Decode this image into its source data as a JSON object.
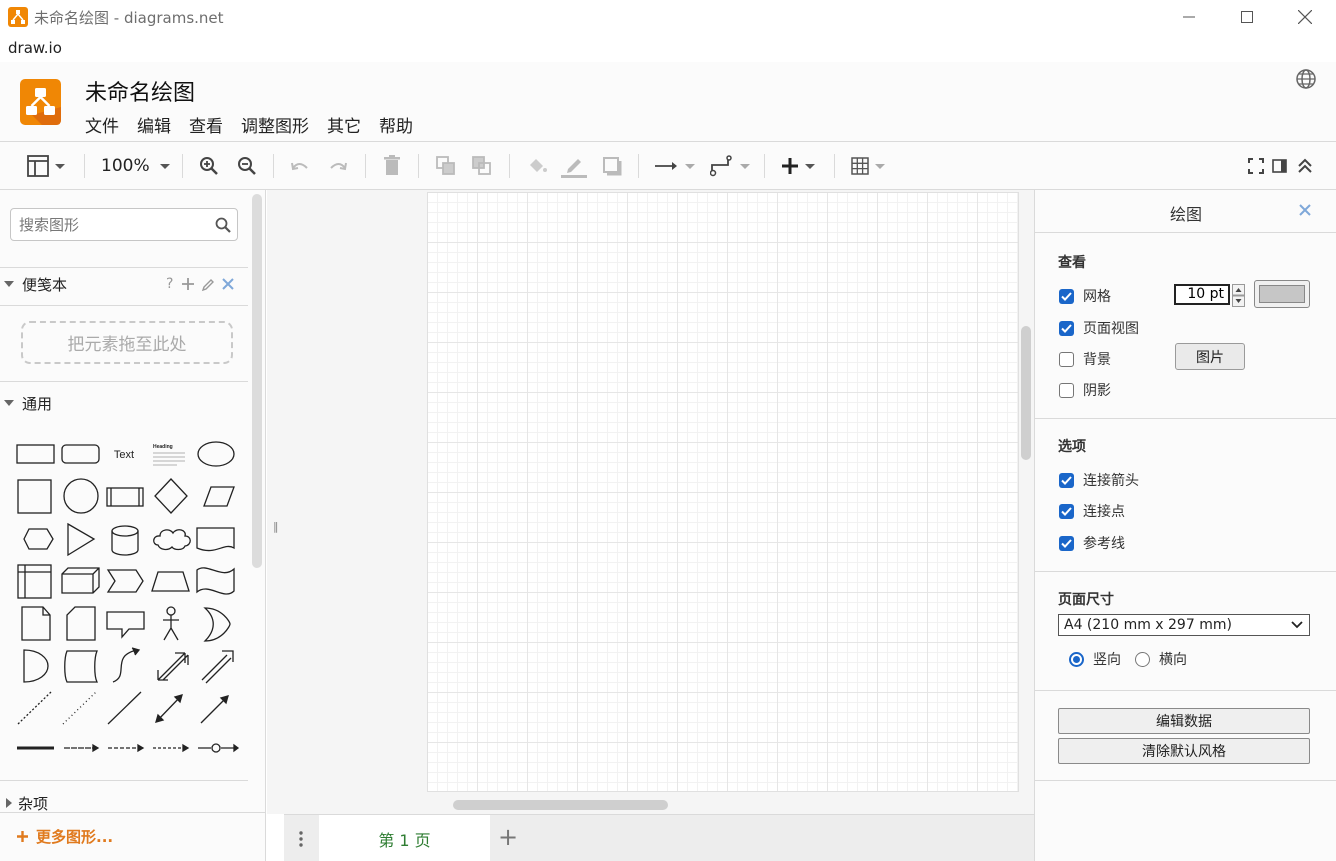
{
  "window": {
    "title": "未命名绘图 - diagrams.net",
    "app_menu": "draw.io"
  },
  "header": {
    "doc_title": "未命名绘图",
    "menus": [
      "文件",
      "编辑",
      "查看",
      "调整图形",
      "其它",
      "帮助"
    ]
  },
  "toolbar": {
    "zoom": "100%"
  },
  "left_panel": {
    "search_placeholder": "搜索图形",
    "scratchpad": {
      "title": "便笺本",
      "help": "?",
      "dropzone": "把元素拖至此处"
    },
    "general_title": "通用",
    "text_shape_label": "Text",
    "heading_shape_label": "Heading",
    "misc_title": "杂项",
    "more_shapes": "更多图形..."
  },
  "pages": {
    "tabs": [
      "第 1 页"
    ],
    "add": "+"
  },
  "right_panel": {
    "title": "绘图",
    "view_section": "查看",
    "view_options": [
      {
        "label": "网格",
        "checked": true
      },
      {
        "label": "页面视图",
        "checked": true
      },
      {
        "label": "背景",
        "checked": false
      },
      {
        "label": "阴影",
        "checked": false
      }
    ],
    "grid_size": "10 pt",
    "image_button": "图片",
    "options_section": "选项",
    "options": [
      {
        "label": "连接箭头",
        "checked": true
      },
      {
        "label": "连接点",
        "checked": true
      },
      {
        "label": "参考线",
        "checked": true
      }
    ],
    "page_size_section": "页面尺寸",
    "page_size": "A4 (210 mm x 297 mm)",
    "orientation": [
      {
        "label": "竖向",
        "selected": true
      },
      {
        "label": "横向",
        "selected": false
      }
    ],
    "edit_data_button": "编辑数据",
    "clear_style_button": "清除默认风格"
  },
  "colors": {
    "accent_orange": "#f08705",
    "checkbox_blue": "#1a66c9",
    "page_tab_green": "#2e7d32",
    "more_shapes_orange": "#e07a1e"
  }
}
